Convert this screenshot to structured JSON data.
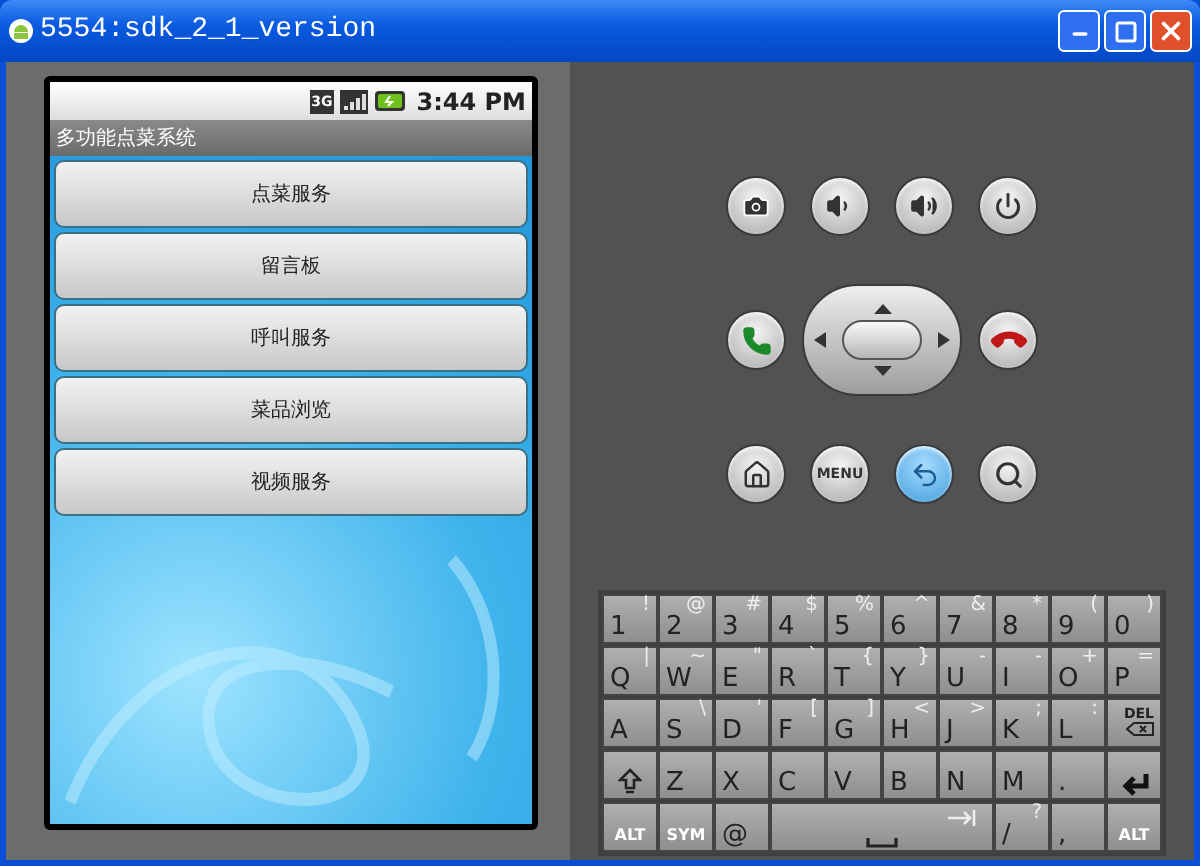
{
  "window": {
    "title": "5554:sdk_2_1_version"
  },
  "phone": {
    "status_bar": {
      "network_label": "3G",
      "time": "3:44 PM"
    },
    "app_title": "多功能点菜系统",
    "menu_buttons": [
      "点菜服务",
      "留言板",
      "呼叫服务",
      "菜品浏览",
      "视频服务"
    ]
  },
  "controls": [
    {
      "kind": "camera",
      "highlighted": false
    },
    {
      "kind": "volume-down",
      "highlighted": false
    },
    {
      "kind": "volume-up",
      "highlighted": false
    },
    {
      "kind": "power",
      "highlighted": false
    },
    {
      "kind": "call",
      "highlighted": false
    },
    {
      "kind": "dpad",
      "highlighted": false
    },
    {
      "kind": "end-call",
      "highlighted": false
    },
    {
      "kind": "home",
      "highlighted": false
    },
    {
      "kind": "menu",
      "label": "MENU",
      "highlighted": false
    },
    {
      "kind": "back",
      "highlighted": true
    },
    {
      "kind": "search",
      "highlighted": false
    }
  ],
  "keyboard": [
    [
      {
        "kind": "char",
        "main": "1",
        "alt": "!"
      },
      {
        "kind": "char",
        "main": "2",
        "alt": "@"
      },
      {
        "kind": "char",
        "main": "3",
        "alt": "#"
      },
      {
        "kind": "char",
        "main": "4",
        "alt": "$"
      },
      {
        "kind": "char",
        "main": "5",
        "alt": "%"
      },
      {
        "kind": "char",
        "main": "6",
        "alt": "^"
      },
      {
        "kind": "char",
        "main": "7",
        "alt": "&"
      },
      {
        "kind": "char",
        "main": "8",
        "alt": "*"
      },
      {
        "kind": "char",
        "main": "9",
        "alt": "("
      },
      {
        "kind": "char",
        "main": "0",
        "alt": ")"
      }
    ],
    [
      {
        "kind": "char",
        "main": "Q",
        "alt": "|"
      },
      {
        "kind": "char",
        "main": "W",
        "alt": "~"
      },
      {
        "kind": "char",
        "main": "E",
        "alt": "\""
      },
      {
        "kind": "char",
        "main": "R",
        "alt": "`"
      },
      {
        "kind": "char",
        "main": "T",
        "alt": "{"
      },
      {
        "kind": "char",
        "main": "Y",
        "alt": "}"
      },
      {
        "kind": "char",
        "main": "U",
        "alt": "-"
      },
      {
        "kind": "char",
        "main": "I",
        "alt": "-"
      },
      {
        "kind": "char",
        "main": "O",
        "alt": "+"
      },
      {
        "kind": "char",
        "main": "P",
        "alt": "="
      }
    ],
    [
      {
        "kind": "char",
        "main": "A"
      },
      {
        "kind": "char",
        "main": "S",
        "alt": "\\"
      },
      {
        "kind": "char",
        "main": "D",
        "alt": "'"
      },
      {
        "kind": "char",
        "main": "F",
        "alt": "["
      },
      {
        "kind": "char",
        "main": "G",
        "alt": "]"
      },
      {
        "kind": "char",
        "main": "H",
        "alt": "<"
      },
      {
        "kind": "char",
        "main": "J",
        "alt": ">"
      },
      {
        "kind": "char",
        "main": "K",
        "alt": ";"
      },
      {
        "kind": "char",
        "main": "L",
        "alt": ":"
      },
      {
        "kind": "del",
        "main": "DEL"
      }
    ],
    [
      {
        "kind": "shift"
      },
      {
        "kind": "char",
        "main": "Z"
      },
      {
        "kind": "char",
        "main": "X"
      },
      {
        "kind": "char",
        "main": "C"
      },
      {
        "kind": "char",
        "main": "V"
      },
      {
        "kind": "char",
        "main": "B"
      },
      {
        "kind": "char",
        "main": "N"
      },
      {
        "kind": "char",
        "main": "M"
      },
      {
        "kind": "char",
        "main": "."
      },
      {
        "kind": "enter"
      }
    ],
    [
      {
        "kind": "mod",
        "main": "ALT"
      },
      {
        "kind": "mod",
        "main": "SYM"
      },
      {
        "kind": "char",
        "main": "@"
      },
      {
        "kind": "space"
      },
      {
        "kind": "char",
        "main": "/",
        "alt": "?"
      },
      {
        "kind": "char",
        "main": ","
      },
      {
        "kind": "mod",
        "main": "ALT"
      }
    ]
  ]
}
